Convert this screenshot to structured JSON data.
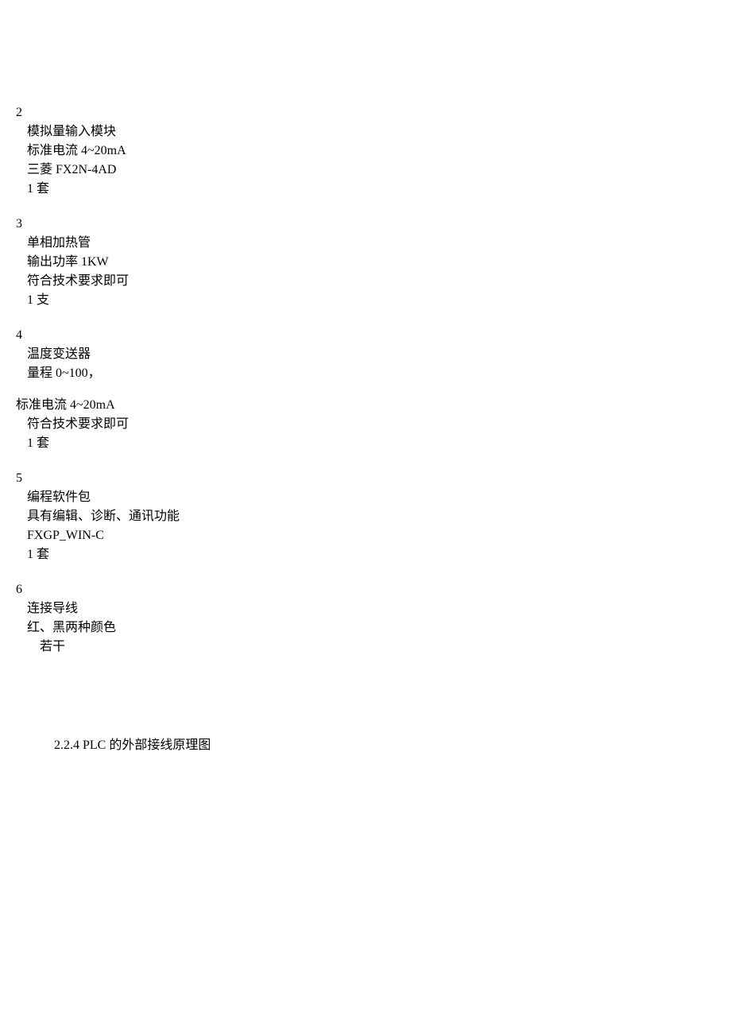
{
  "items": [
    {
      "num": "2",
      "name": "模拟量输入模块",
      "spec": "标准电流 4~20mA",
      "model": "三菱 FX2N-4AD",
      "qty": "1 套"
    },
    {
      "num": "3",
      "name": "单相加热管",
      "spec": "输出功率 1KW",
      "model": "符合技术要求即可",
      "qty": "1 支"
    },
    {
      "num": "4",
      "name": "温度变送器",
      "spec": "量程 0~100，",
      "spec2": "标准电流 4~20mA",
      "model": "符合技术要求即可",
      "qty": "1 套"
    },
    {
      "num": "5",
      "name": "编程软件包",
      "spec": "具有编辑、诊断、通讯功能",
      "model": "FXGP_WIN-C",
      "qty": "1 套"
    },
    {
      "num": "6",
      "name": "连接导线",
      "spec": "红、黑两种颜色",
      "qty": "若干"
    }
  ],
  "section_heading": "2.2.4 PLC 的外部接线原理图"
}
